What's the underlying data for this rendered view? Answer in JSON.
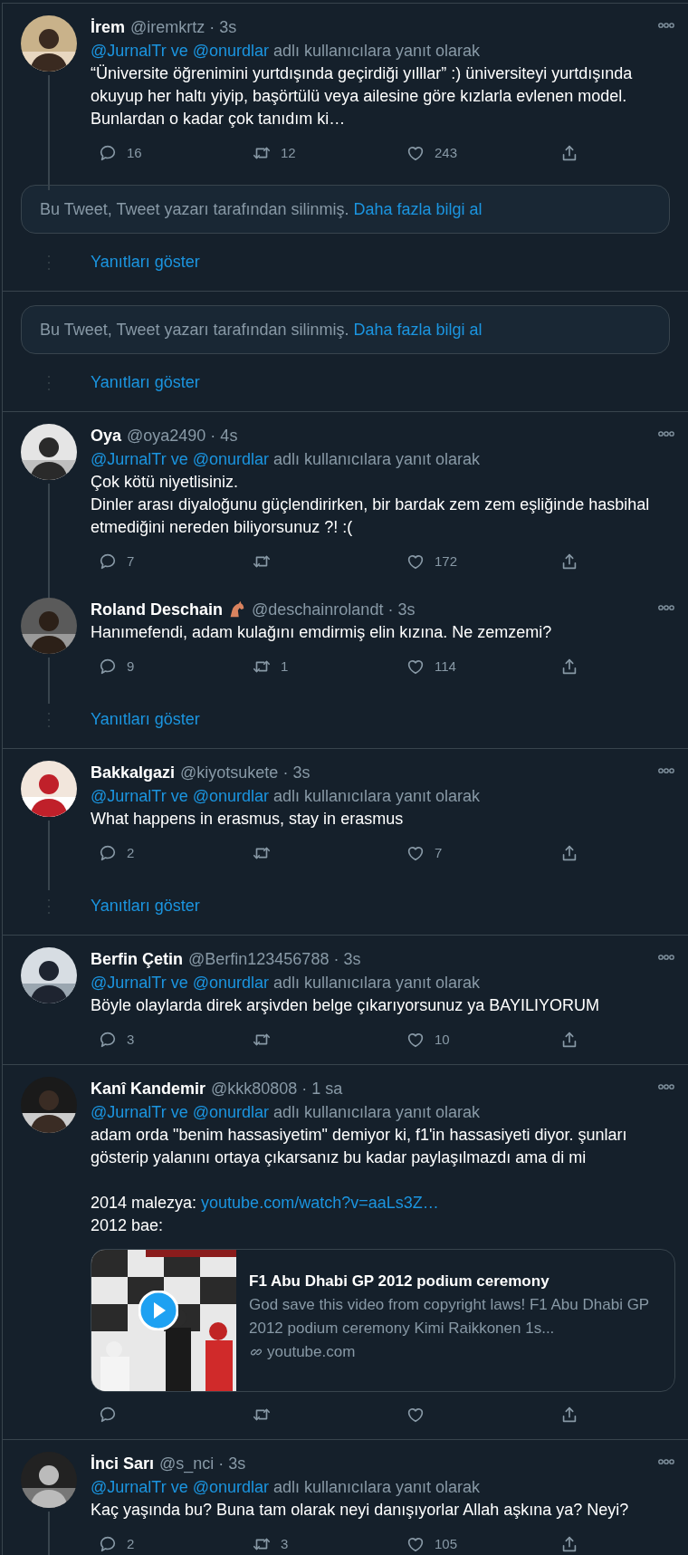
{
  "feed": [
    {
      "items": [
        {
          "kind": "tweet",
          "name": "İrem",
          "meta": "@iremkrtz · 3s",
          "reply_to": {
            "mentions": [
              "@JurnalTr",
              "@onurdlar"
            ],
            "joiner": "ve",
            "suffix": "adlı kullanıcılara yanıt olarak"
          },
          "body": [
            {
              "kind": "text",
              "text": "“Üniversite öğrenimini yurtdışında geçirdiği yılllar” :) üniversiteyi yurtdışında okuyup her haltı yiyip, başörtülü veya ailesine göre kızlarla evlenen model. Bunlardan o kadar çok tanıdım ki…"
            }
          ],
          "replies": "16",
          "retweets": "12",
          "likes": "243",
          "thread_line": true
        },
        {
          "kind": "deleted",
          "text": "Bu Tweet, Tweet yazarı tarafından silinmiş.",
          "link": "Daha fazla bilgi al"
        },
        {
          "kind": "show_replies",
          "label": "Yanıtları göster"
        }
      ]
    },
    {
      "items": [
        {
          "kind": "deleted",
          "text": "Bu Tweet, Tweet yazarı tarafından silinmiş.",
          "link": "Daha fazla bilgi al"
        },
        {
          "kind": "show_replies",
          "label": "Yanıtları göster"
        }
      ]
    },
    {
      "items": [
        {
          "kind": "tweet",
          "name": "Oya",
          "meta": "@oya2490 · 4s",
          "reply_to": {
            "mentions": [
              "@JurnalTr",
              "@onurdlar"
            ],
            "joiner": "ve",
            "suffix": "adlı kullanıcılara yanıt olarak"
          },
          "body": [
            {
              "kind": "text",
              "text": "Çok kötü niyetlisiniz.\nDinler arası diyaloğunu güçlendirirken, bir bardak zem zem eşliğinde hasbihal etmediğini nereden biliyorsunuz ?! :("
            }
          ],
          "replies": "7",
          "likes": "172",
          "thread_line": true
        },
        {
          "kind": "tweet",
          "name": "Roland Deschain",
          "name_badge": {
            "kind": "horse"
          },
          "meta": "@deschainrolandt · 3s",
          "body": [
            {
              "kind": "text",
              "text": "Hanımefendi, adam kulağını emdirmiş elin kızına. Ne zemzemi?"
            }
          ],
          "replies": "9",
          "retweets": "1",
          "likes": "114",
          "thread_line": true
        },
        {
          "kind": "show_replies",
          "label": "Yanıtları göster"
        }
      ]
    },
    {
      "items": [
        {
          "kind": "tweet",
          "name": "Bakkalgazi",
          "meta": "@kiyotsukete · 3s",
          "reply_to": {
            "mentions": [
              "@JurnalTr",
              "@onurdlar"
            ],
            "joiner": "ve",
            "suffix": "adlı kullanıcılara yanıt olarak"
          },
          "body": [
            {
              "kind": "text",
              "text": "What happens in erasmus, stay in erasmus"
            }
          ],
          "replies": "2",
          "likes": "7",
          "thread_line": true
        },
        {
          "kind": "show_replies",
          "label": "Yanıtları göster"
        }
      ]
    },
    {
      "items": [
        {
          "kind": "tweet",
          "name": "Berfin Çetin",
          "meta": "@Berfin123456788 · 3s",
          "reply_to": {
            "mentions": [
              "@JurnalTr",
              "@onurdlar"
            ],
            "joiner": "ve",
            "suffix": "adlı kullanıcılara yanıt olarak"
          },
          "body": [
            {
              "kind": "text",
              "text": "Böyle olaylarda direk arşivden belge çıkarıyorsunuz ya BAYILIYORUM"
            }
          ],
          "replies": "3",
          "likes": "10",
          "thread_line": false
        }
      ]
    },
    {
      "items": [
        {
          "kind": "tweet",
          "name": "Kanî Kandemir",
          "meta": "@kkk80808 · 1 sa",
          "reply_to": {
            "mentions": [
              "@JurnalTr",
              "@onurdlar"
            ],
            "joiner": "ve",
            "suffix": "adlı kullanıcılara yanıt olarak"
          },
          "body": [
            {
              "kind": "text",
              "text": "adam orda \"benim hassasiyetim\" demiyor ki, f1'in hassasiyeti diyor. şunları gösterip yalanını ortaya çıkarsanız bu kadar paylaşılmazdı ama di mi\n\n2014 malezya: "
            },
            {
              "kind": "link",
              "text": "youtube.com/watch?v=aaLs3Z…"
            },
            {
              "kind": "text",
              "text": "\n2012 bae:"
            }
          ],
          "card": {
            "kind": "video",
            "title": "F1 Abu Dhabi GP 2012 podium ceremony",
            "description": "God save this video from copyright laws! F1 Abu Dhabi GP 2012 podium ceremony Kimi Raikkonen 1s...",
            "domain": "youtube.com"
          },
          "thread_line": false
        }
      ]
    },
    {
      "items": [
        {
          "kind": "tweet",
          "name": "İnci Sarı",
          "meta": "@s_nci · 3s",
          "reply_to": {
            "mentions": [
              "@JurnalTr",
              "@onurdlar"
            ],
            "joiner": "ve",
            "suffix": "adlı kullanıcılara yanıt olarak"
          },
          "body": [
            {
              "kind": "text",
              "text": "Kaç yaşında bu? Buna tam olarak neyi danışıyorlar Allah aşkına ya? Neyi?"
            }
          ],
          "replies": "2",
          "retweets": "3",
          "likes": "105",
          "thread_line": true
        }
      ]
    }
  ]
}
